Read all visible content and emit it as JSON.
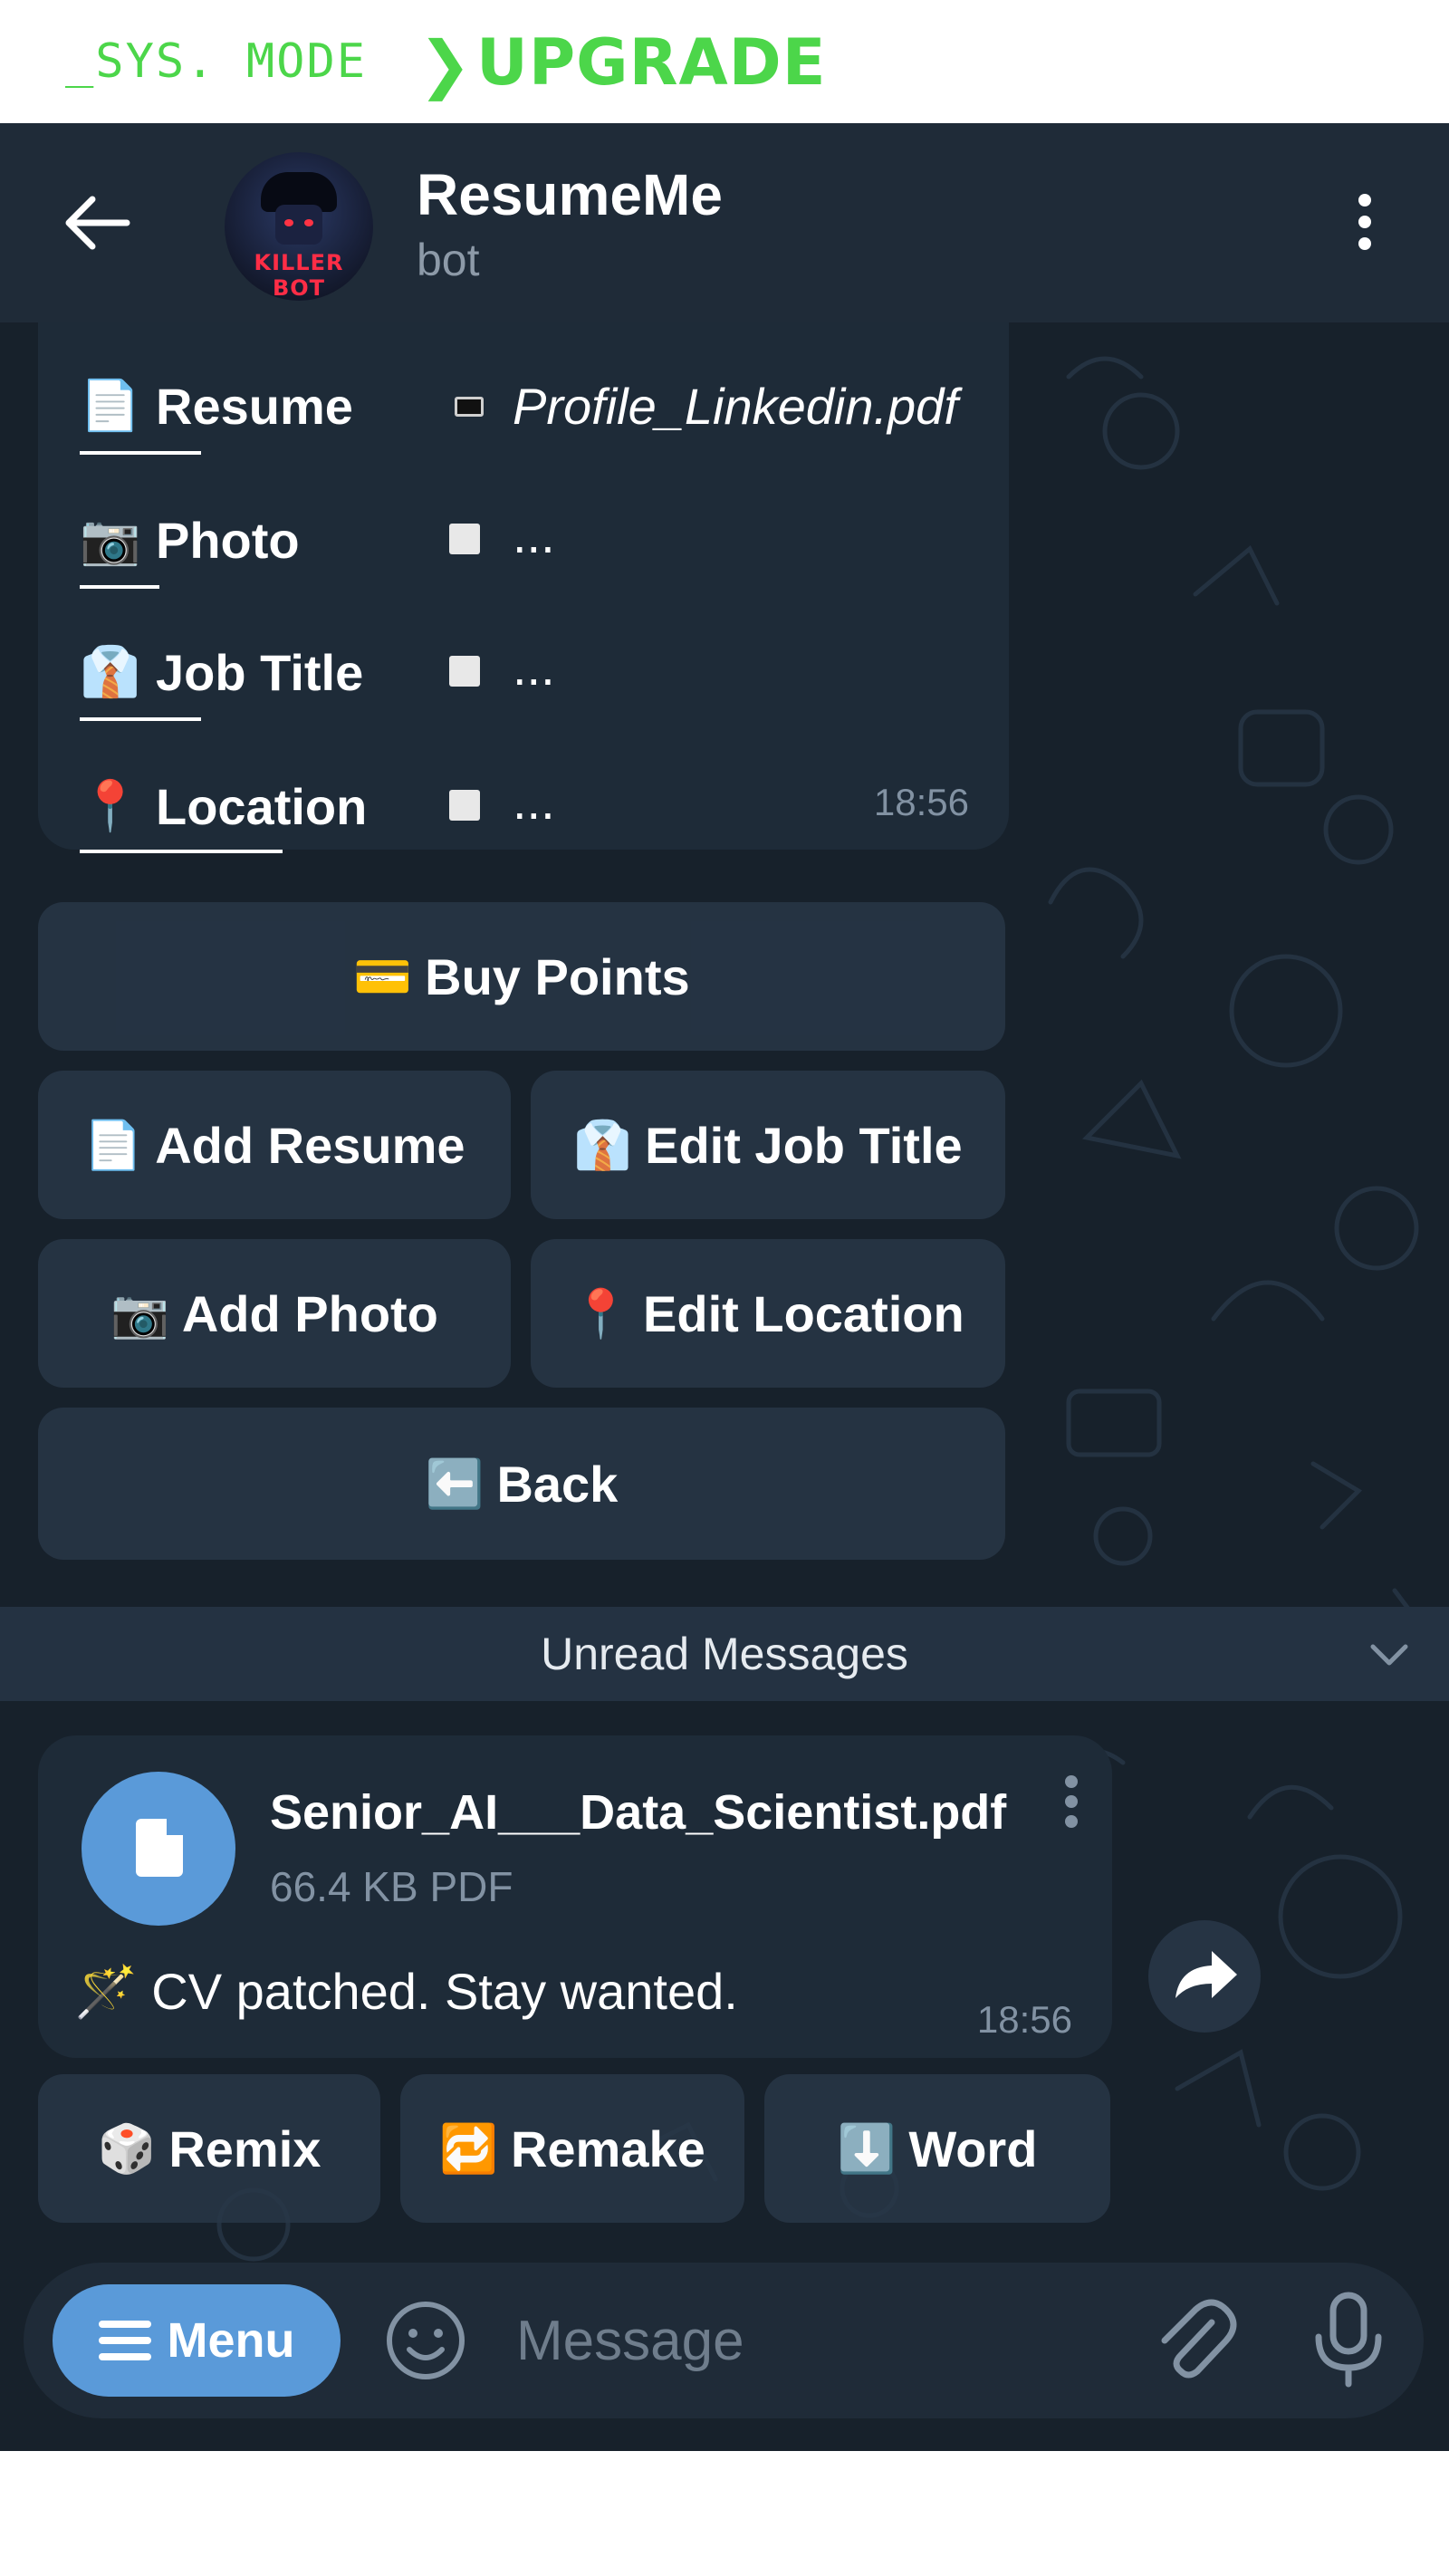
{
  "banner": {
    "sys_mode": "_SYS. MODE",
    "chevron": "❯",
    "upgrade": "UPGRADE",
    "accent": "#4cd64a"
  },
  "header": {
    "back_icon": "arrow-left-icon",
    "avatar_text": "KILLER BOT",
    "title": "ResumeMe",
    "subtitle": "bot",
    "menu_icon": "vertical-dots-icon"
  },
  "profile": {
    "rows": [
      {
        "icon": "📄",
        "label": "Resume",
        "value": "Profile_Linkedin.pdf"
      },
      {
        "icon": "📷",
        "label": "Photo",
        "value": "..."
      },
      {
        "icon": "👔",
        "label": "Job Title",
        "value": "..."
      },
      {
        "icon": "📍",
        "label": "Location",
        "value": "..."
      }
    ],
    "time": "18:56"
  },
  "keyboard": {
    "buy_points": {
      "icon": "💳",
      "label": "Buy Points"
    },
    "add_resume": {
      "icon": "📄",
      "label": "Add Resume"
    },
    "edit_job_title": {
      "icon": "👔",
      "label": "Edit Job Title"
    },
    "add_photo": {
      "icon": "📷",
      "label": "Add Photo"
    },
    "edit_location": {
      "icon": "📍",
      "label": "Edit Location"
    },
    "back": {
      "icon": "⬅️",
      "label": "Back"
    }
  },
  "unread": {
    "label": "Unread Messages"
  },
  "file_message": {
    "file_name": "Senior_AI___Data_Scientist.pdf",
    "file_meta": "66.4 KB PDF",
    "caption_icon": "🪄",
    "caption": "CV patched. Stay wanted.",
    "time": "18:56"
  },
  "file_keyboard": {
    "remix": {
      "icon": "🎲",
      "label": "Remix"
    },
    "remake": {
      "icon": "🔁",
      "label": "Remake"
    },
    "word": {
      "icon": "⬇️",
      "label": "Word"
    }
  },
  "input": {
    "menu_label": "Menu",
    "placeholder": "Message"
  },
  "colors": {
    "bg": "#17212b",
    "header": "#1f2b38",
    "bubble": "#1e2b38",
    "accent_blue": "#5a9ad9"
  }
}
